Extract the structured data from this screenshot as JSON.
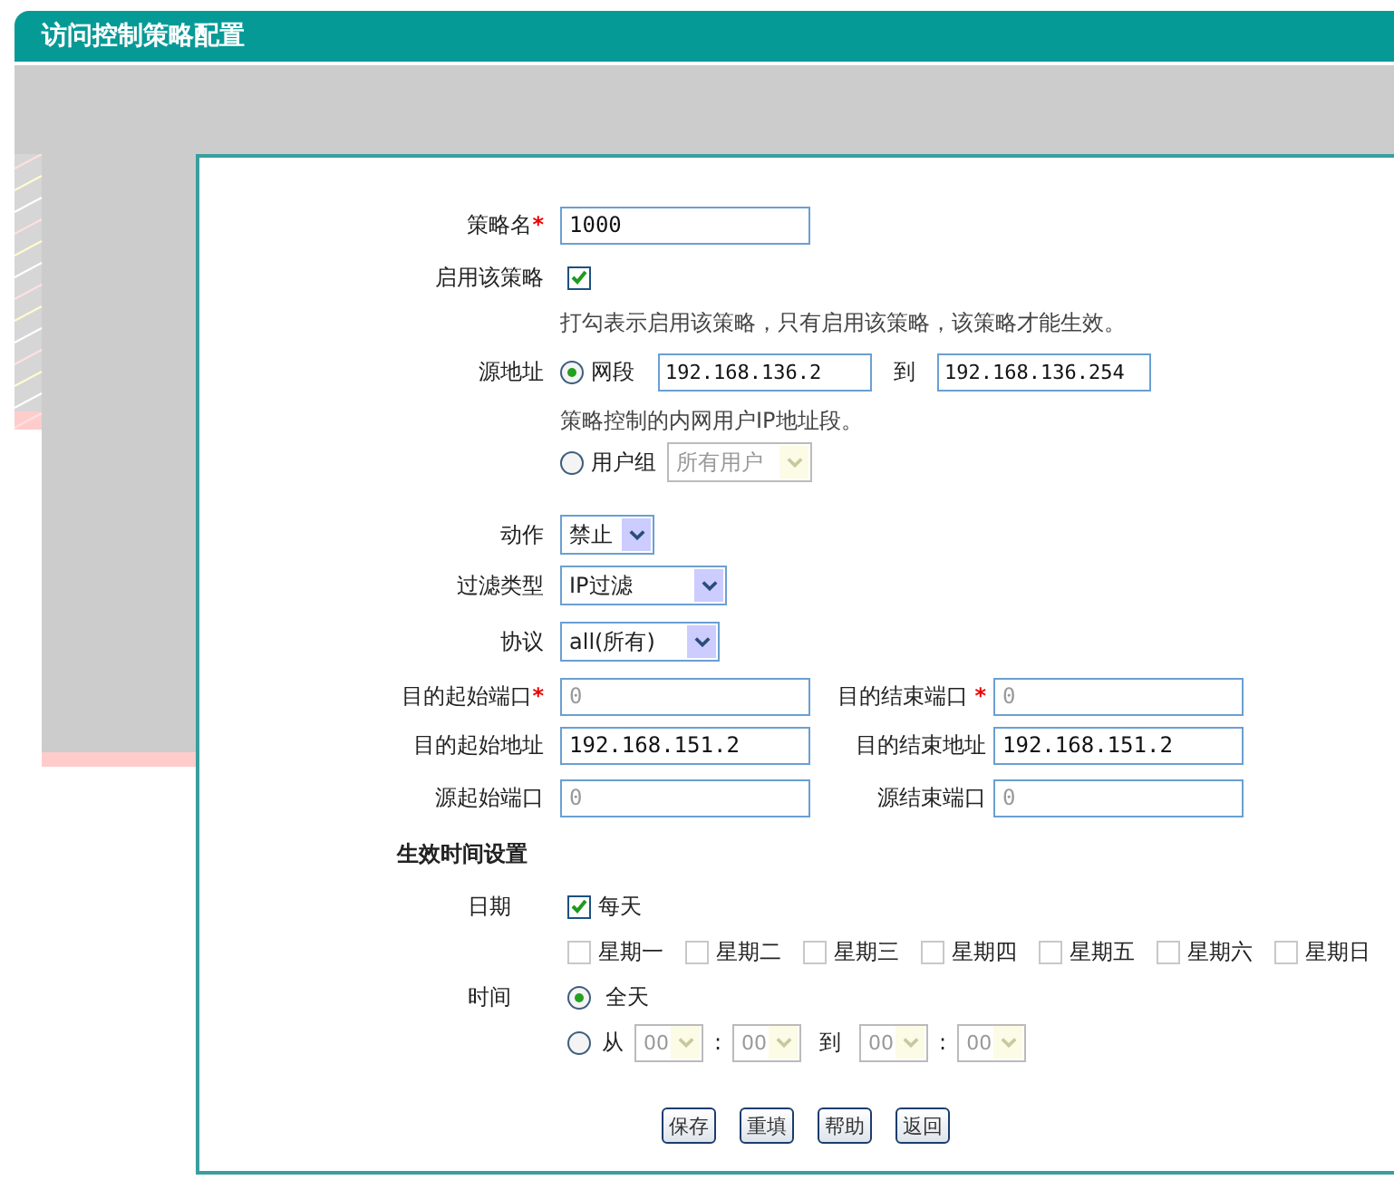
{
  "title": "访问控制策略配置",
  "policy_name": {
    "label": "策略名",
    "mark": "*",
    "value": "1000"
  },
  "enable": {
    "label": "启用该策略",
    "checked": true,
    "hint": "打勾表示启用该策略，只有启用该策略，该策略才能生效。"
  },
  "source": {
    "label": "源地址",
    "options": [
      {
        "kind": "range",
        "label": "网段",
        "selected": true,
        "from": "192.168.136.2",
        "sep": "到",
        "to": "192.168.136.254",
        "hint": "策略控制的内网用户IP地址段。"
      },
      {
        "kind": "group",
        "label": "用户组",
        "selected": false,
        "value": "所有用户",
        "disabled": true
      }
    ]
  },
  "selects": [
    {
      "label": "动作",
      "value": "禁止"
    },
    {
      "label": "过滤类型",
      "value": "IP过滤"
    },
    {
      "label": "协议",
      "value": "all(所有)"
    }
  ],
  "pairs": [
    [
      {
        "label": "目的起始端口",
        "mark": "*",
        "placeholder": "0"
      },
      {
        "label": "目的结束端口 ",
        "mark": "*",
        "placeholder": "0"
      }
    ],
    [
      {
        "label": "目的起始地址",
        "value": "192.168.151.2"
      },
      {
        "label": "目的结束地址",
        "value": "192.168.151.2"
      }
    ],
    [
      {
        "label": "源起始端口",
        "placeholder": "0"
      },
      {
        "label": "源结束端口",
        "placeholder": "0"
      }
    ]
  ],
  "schedule": {
    "title": "生效时间设置",
    "date_label": "日期",
    "everyday": {
      "label": "每天",
      "checked": true
    },
    "weekdays": [
      {
        "label": "星期一",
        "checked": false,
        "disabled": true
      },
      {
        "label": "星期二",
        "checked": false,
        "disabled": true
      },
      {
        "label": "星期三",
        "checked": false,
        "disabled": true
      },
      {
        "label": "星期四",
        "checked": false,
        "disabled": true
      },
      {
        "label": "星期五",
        "checked": false,
        "disabled": true
      },
      {
        "label": "星期六",
        "checked": false,
        "disabled": true
      },
      {
        "label": "星期日",
        "checked": false,
        "disabled": true
      }
    ],
    "time_label": "时间",
    "time_options": [
      {
        "kind": "all_day",
        "label": "全天",
        "selected": true
      },
      {
        "kind": "range",
        "label": "从",
        "selected": false,
        "disabled": true,
        "start_hour": "00",
        "colon": ":",
        "start_minute": "00",
        "sep": "到",
        "end_hour": "00",
        "end_minute": "00"
      }
    ]
  },
  "buttons": [
    "保存",
    "重填",
    "帮助",
    "返回"
  ]
}
